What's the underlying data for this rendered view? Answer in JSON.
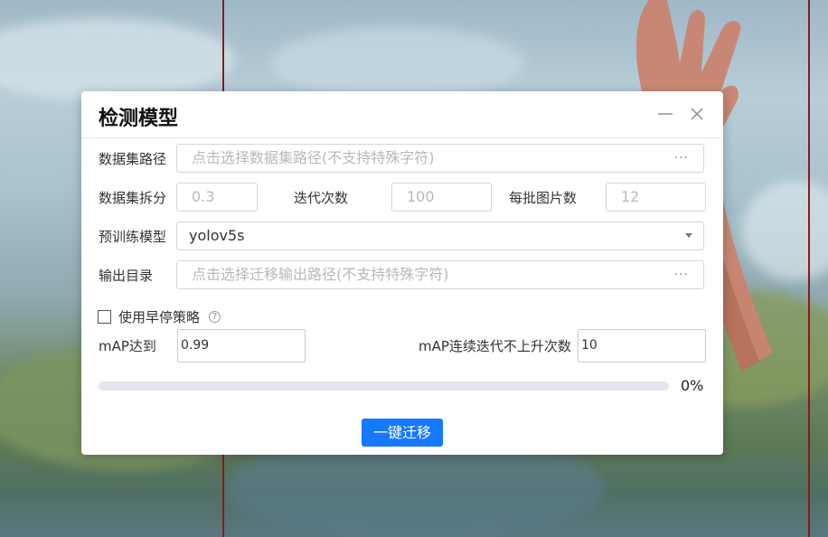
{
  "dialog": {
    "title": "检测模型",
    "dataset_path": {
      "label": "数据集路径",
      "placeholder": "点击选择数据集路径(不支持特殊字符)",
      "more": "···"
    },
    "dataset_split": {
      "label": "数据集拆分",
      "placeholder": "0.3"
    },
    "iterations": {
      "label": "迭代次数",
      "placeholder": "100"
    },
    "batch_size": {
      "label": "每批图片数",
      "placeholder": "12"
    },
    "pretrained_model": {
      "label": "预训练模型",
      "value": "yolov5s"
    },
    "output_dir": {
      "label": "输出目录",
      "placeholder": "点击选择迁移输出路径(不支持特殊字符)",
      "more": "···"
    },
    "early_stop": {
      "label": "使用早停策略",
      "checked": false,
      "help": "?"
    },
    "map_target": {
      "label": "mAP达到",
      "value": "0.99"
    },
    "map_patience": {
      "label": "mAP连续迭代不上升次数",
      "value": "10"
    },
    "progress": {
      "value": 0,
      "text": "0%"
    },
    "submit_label": "一键迁移"
  },
  "colors": {
    "primary": "#1677ff",
    "progress_track": "#e4e7ee",
    "border": "#d3d6dc"
  }
}
